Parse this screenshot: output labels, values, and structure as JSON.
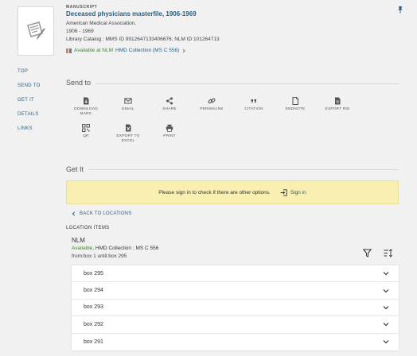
{
  "record": {
    "type": "MANUSCRIPT",
    "title": "Deceased physicians masterfile, 1906-1969",
    "author": "American Medical Association.",
    "dates": "1906 - 1969",
    "ids": "Library Catalog ; MMS ID 9912647133406676; NLM ID 101264713",
    "availability_status": "Available at NLM",
    "availability_location": "HMD Collection (MS C 556)"
  },
  "nav": {
    "items": [
      "TOP",
      "SEND TO",
      "GET IT",
      "DETAILS",
      "LINKS"
    ]
  },
  "send_to": {
    "heading": "Send to",
    "actions": [
      {
        "label": "DOWNLOAD MARC",
        "icon": "download-icon"
      },
      {
        "label": "EMAIL",
        "icon": "email-icon"
      },
      {
        "label": "SHARE",
        "icon": "share-icon"
      },
      {
        "label": "PERMALINK",
        "icon": "link-icon"
      },
      {
        "label": "CITATION",
        "icon": "quote-icon"
      },
      {
        "label": "ENDNOTE",
        "icon": "document-icon"
      },
      {
        "label": "EXPORT RIS",
        "icon": "export-ris-icon"
      },
      {
        "label": "QR",
        "icon": "qr-icon"
      },
      {
        "label": "EXPORT TO EXCEL",
        "icon": "excel-icon"
      },
      {
        "label": "PRINT",
        "icon": "print-icon"
      }
    ]
  },
  "get_it": {
    "heading": "Get It",
    "banner_text": "Please sign in to check if there are other options.",
    "sign_in_label": "Sign in",
    "back_label": "BACK TO LOCATIONS",
    "location_items_label": "LOCATION ITEMS",
    "library": "NLM",
    "library_status": "Available",
    "library_location": ", HMD Collection ; MS C 556",
    "range": "from:box 1 until:box 295",
    "items": [
      "box 295",
      "box 294",
      "box 293",
      "box 292",
      "box 291"
    ]
  },
  "colors": {
    "link": "#2c5f7f",
    "available": "#3c8a2e",
    "banner": "#f8efb0",
    "background": "#f1f1f1"
  }
}
